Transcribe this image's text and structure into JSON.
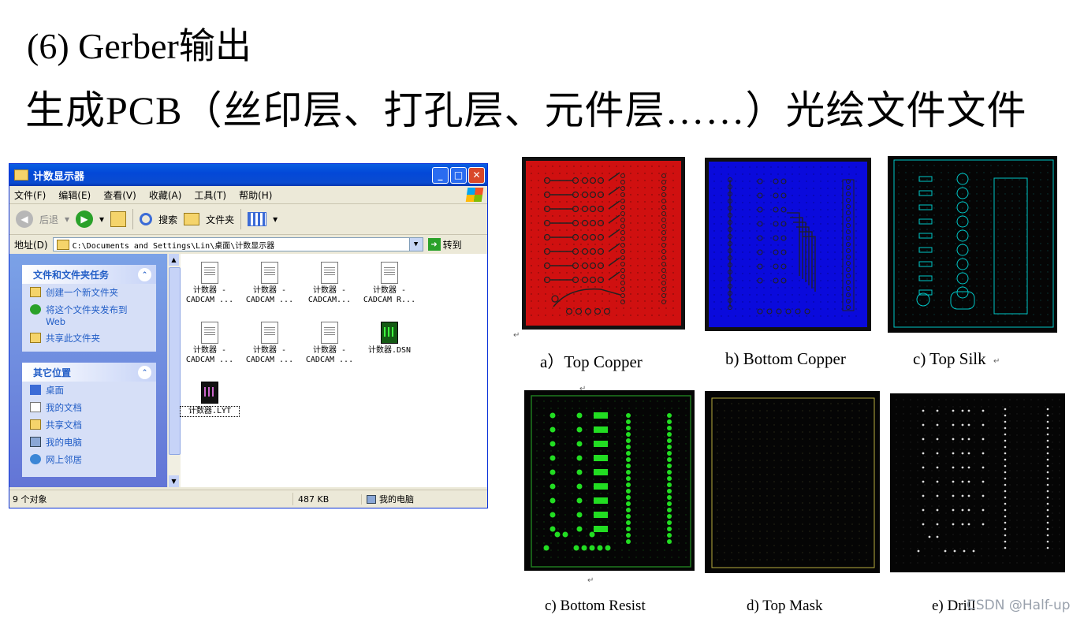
{
  "slide": {
    "title": "(6) Gerber输出",
    "subtitle": "生成PCB（丝印层、打孔层、元件层……）光绘文件文件"
  },
  "explorer": {
    "window_title": "计数显示器",
    "menu": [
      "文件(F)",
      "编辑(E)",
      "查看(V)",
      "收藏(A)",
      "工具(T)",
      "帮助(H)"
    ],
    "toolbar": {
      "back": "后退",
      "search": "搜索",
      "folders": "文件夹"
    },
    "address": {
      "label": "地址(D)",
      "value": "C:\\Documents and Settings\\Lin\\桌面\\计数显示器",
      "go": "转到"
    },
    "tasks": {
      "title": "文件和文件夹任务",
      "items": [
        "创建一个新文件夹",
        "将这个文件夹发布到",
        "Web",
        "共享此文件夹"
      ]
    },
    "places": {
      "title": "其它位置",
      "items": [
        "桌面",
        "我的文档",
        "共享文档",
        "我的电脑",
        "网上邻居"
      ]
    },
    "files": [
      {
        "l1": "计数器 -",
        "l2": "CADCAM ..."
      },
      {
        "l1": "计数器 -",
        "l2": "CADCAM ..."
      },
      {
        "l1": "计数器 -",
        "l2": "CADCAM..."
      },
      {
        "l1": "计数器 -",
        "l2": "CADCAM R..."
      },
      {
        "l1": "计数器 -",
        "l2": "CADCAM ..."
      },
      {
        "l1": "计数器 -",
        "l2": "CADCAM ..."
      },
      {
        "l1": "计数器 -",
        "l2": "CADCAM ..."
      },
      {
        "l1": "计数器.DSN",
        "l2": ""
      },
      {
        "l1": "计数器.LYT",
        "l2": ""
      }
    ],
    "status": {
      "count": "9 个对象",
      "size": "487 KB",
      "location": "我的电脑"
    }
  },
  "panels": {
    "top_copper": {
      "caption": "a）Top Copper",
      "color": "#d01010"
    },
    "bottom_copper": {
      "caption": "b) Bottom Copper",
      "color": "#0a0adc"
    },
    "top_silk": {
      "caption": "c) Top Silk",
      "color": "#00c8c8"
    },
    "bottom_resist": {
      "caption": "c) Bottom Resist",
      "color": "#22dd22"
    },
    "top_mask": {
      "caption": "d) Top Mask",
      "color": "#d2c85a"
    },
    "drill": {
      "caption": "e) Drill",
      "color": "#dddddd"
    }
  },
  "watermark": "CSDN @Half-up"
}
